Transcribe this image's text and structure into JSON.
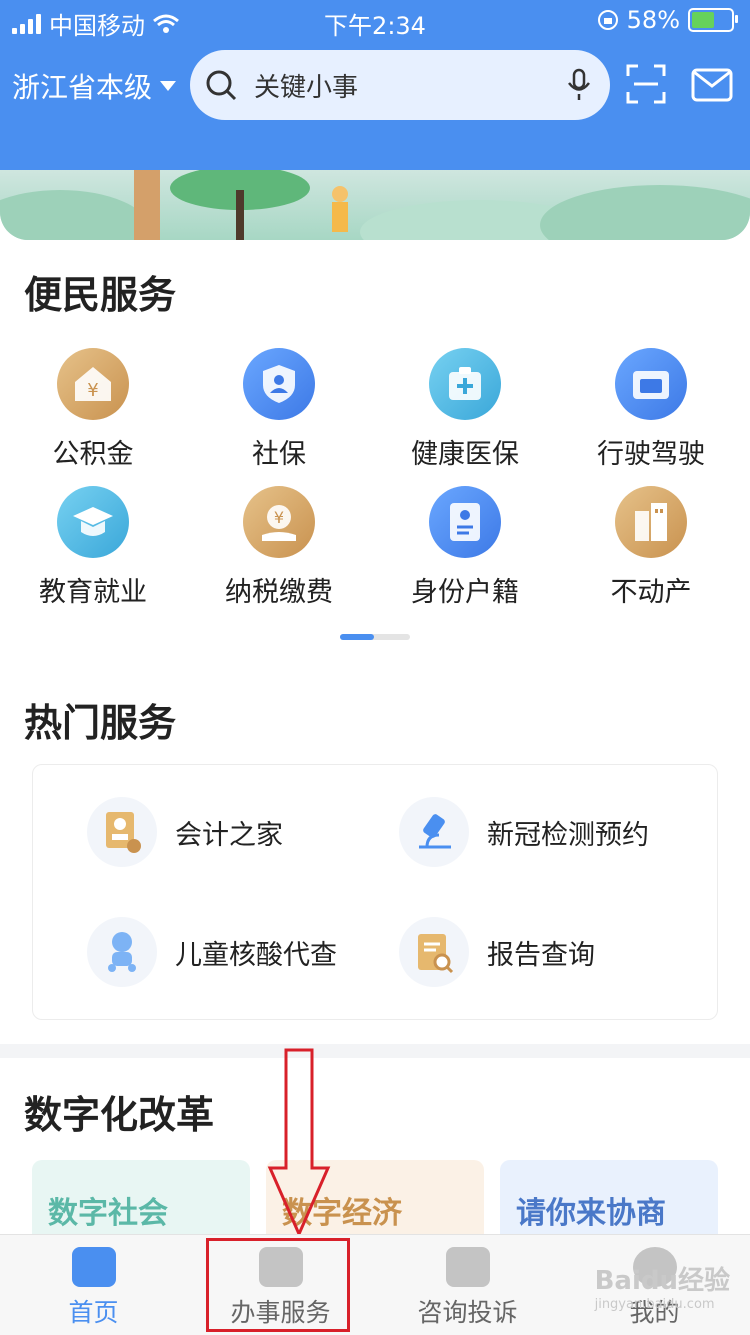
{
  "status_bar": {
    "carrier": "中国移动",
    "time": "下午2:34",
    "battery_percent": "58%",
    "battery_level": 0.58
  },
  "header": {
    "region": "浙江省本级",
    "search_placeholder": "关键小事",
    "icons": [
      "search-icon",
      "mic-icon",
      "scan-icon",
      "mail-icon"
    ]
  },
  "convenience": {
    "title": "便民服务",
    "items": [
      {
        "label": "公积金",
        "icon": "house-yen-icon"
      },
      {
        "label": "社保",
        "icon": "shield-person-icon"
      },
      {
        "label": "健康医保",
        "icon": "medical-kit-icon"
      },
      {
        "label": "行驶驾驶",
        "icon": "driver-license-icon"
      },
      {
        "label": "教育就业",
        "icon": "graduation-cap-icon"
      },
      {
        "label": "纳税缴费",
        "icon": "coin-hand-icon"
      },
      {
        "label": "身份户籍",
        "icon": "id-card-icon"
      },
      {
        "label": "不动产",
        "icon": "building-icon"
      }
    ]
  },
  "hot": {
    "title": "热门服务",
    "items": [
      {
        "label": "会计之家",
        "icon": "accountant-icon"
      },
      {
        "label": "新冠检测预约",
        "icon": "microscope-icon"
      },
      {
        "label": "儿童核酸代查",
        "icon": "baby-icon"
      },
      {
        "label": "报告查询",
        "icon": "report-search-icon"
      }
    ]
  },
  "digital": {
    "title": "数字化改革",
    "cards": [
      "数字社会",
      "数字经济",
      "请你来协商"
    ]
  },
  "bottom_nav": {
    "items": [
      {
        "label": "首页",
        "active": true
      },
      {
        "label": "办事服务",
        "active": false
      },
      {
        "label": "咨询投诉",
        "active": false
      },
      {
        "label": "我的",
        "active": false
      }
    ]
  },
  "watermark": {
    "brand": "Baidu经验",
    "url": "jingyan.baidu.com"
  },
  "colors": {
    "primary": "#4a8ff0",
    "gold": "#c9924f",
    "annotation_red": "#d8202a"
  }
}
